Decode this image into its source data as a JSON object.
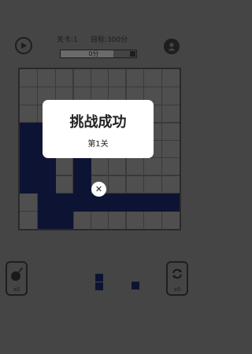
{
  "header": {
    "level_label": "关卡:1",
    "target_label": "目标:300分",
    "progress_text": "0分",
    "progress_fraction": 0.7
  },
  "board": {
    "grid_size": 9,
    "filled_cells": [
      [
        2,
        4
      ],
      [
        3,
        0
      ],
      [
        3,
        1
      ],
      [
        3,
        2
      ],
      [
        4,
        0
      ],
      [
        4,
        1
      ],
      [
        4,
        2
      ],
      [
        5,
        0
      ],
      [
        5,
        1
      ],
      [
        5,
        3
      ],
      [
        6,
        0
      ],
      [
        6,
        1
      ],
      [
        6,
        3
      ],
      [
        7,
        1
      ],
      [
        7,
        2
      ],
      [
        7,
        3
      ],
      [
        7,
        4
      ],
      [
        7,
        5
      ],
      [
        7,
        6
      ],
      [
        7,
        7
      ],
      [
        7,
        8
      ],
      [
        8,
        1
      ],
      [
        8,
        2
      ]
    ]
  },
  "pieces": [
    {
      "cells": [
        [
          0,
          0
        ],
        [
          1,
          0
        ]
      ]
    },
    {
      "cells": [
        [
          0,
          0
        ]
      ]
    }
  ],
  "dialog": {
    "title": "挑战成功",
    "level_text": "第1关",
    "close_glyph": "✕"
  },
  "side": {
    "bomb_count": "x0",
    "refresh_count": "x0"
  },
  "colors": {
    "background": "#454545",
    "block": "#0d1433",
    "dialog": "#ffffff"
  },
  "icons": [
    "play-icon",
    "user-icon",
    "bomb-icon",
    "refresh-icon",
    "close-icon"
  ]
}
